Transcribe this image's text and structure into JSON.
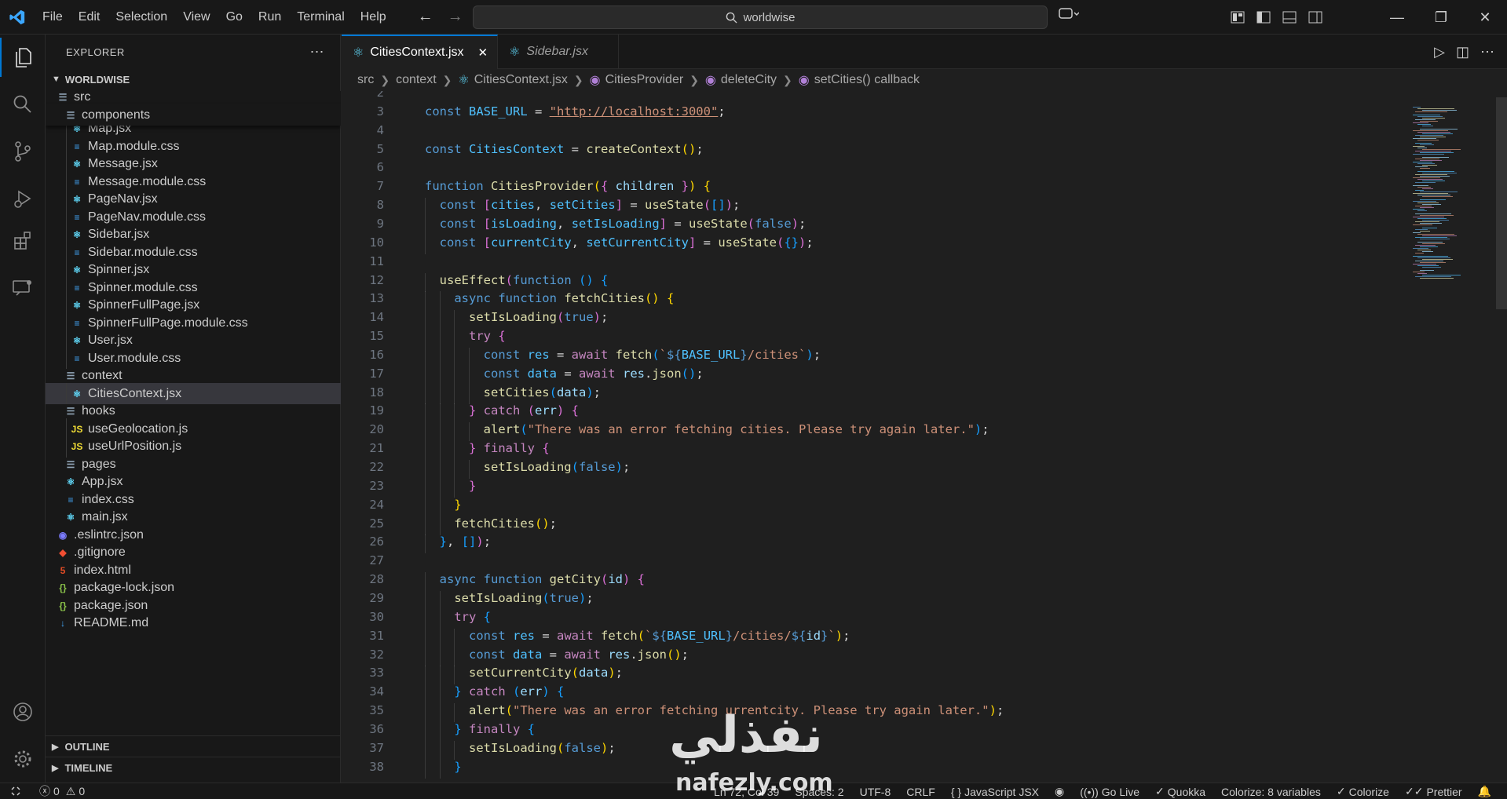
{
  "titlebar": {
    "menu": [
      "File",
      "Edit",
      "Selection",
      "View",
      "Go",
      "Run",
      "Terminal",
      "Help"
    ],
    "search_text": "worldwise"
  },
  "sidebar": {
    "header": "EXPLORER",
    "project": "WORLDWISE",
    "tree": [
      {
        "label": "src",
        "depth": 0,
        "type": "folder"
      },
      {
        "label": "components",
        "depth": 1,
        "type": "folder"
      },
      {
        "label": "Map.jsx",
        "depth": 2,
        "type": "react"
      },
      {
        "label": "Map.module.css",
        "depth": 2,
        "type": "css"
      },
      {
        "label": "Message.jsx",
        "depth": 2,
        "type": "react"
      },
      {
        "label": "Message.module.css",
        "depth": 2,
        "type": "css"
      },
      {
        "label": "PageNav.jsx",
        "depth": 2,
        "type": "react"
      },
      {
        "label": "PageNav.module.css",
        "depth": 2,
        "type": "css"
      },
      {
        "label": "Sidebar.jsx",
        "depth": 2,
        "type": "react"
      },
      {
        "label": "Sidebar.module.css",
        "depth": 2,
        "type": "css"
      },
      {
        "label": "Spinner.jsx",
        "depth": 2,
        "type": "react"
      },
      {
        "label": "Spinner.module.css",
        "depth": 2,
        "type": "css"
      },
      {
        "label": "SpinnerFullPage.jsx",
        "depth": 2,
        "type": "react"
      },
      {
        "label": "SpinnerFullPage.module.css",
        "depth": 2,
        "type": "css"
      },
      {
        "label": "User.jsx",
        "depth": 2,
        "type": "react"
      },
      {
        "label": "User.module.css",
        "depth": 2,
        "type": "css"
      },
      {
        "label": "context",
        "depth": 1,
        "type": "folder"
      },
      {
        "label": "CitiesContext.jsx",
        "depth": 2,
        "type": "react",
        "selected": true
      },
      {
        "label": "hooks",
        "depth": 1,
        "type": "folder"
      },
      {
        "label": "useGeolocation.js",
        "depth": 2,
        "type": "js"
      },
      {
        "label": "useUrlPosition.js",
        "depth": 2,
        "type": "js"
      },
      {
        "label": "pages",
        "depth": 1,
        "type": "folder"
      },
      {
        "label": "App.jsx",
        "depth": 1,
        "type": "react"
      },
      {
        "label": "index.css",
        "depth": 1,
        "type": "css"
      },
      {
        "label": "main.jsx",
        "depth": 1,
        "type": "react"
      },
      {
        "label": ".eslintrc.json",
        "depth": 0,
        "type": "eslint"
      },
      {
        "label": ".gitignore",
        "depth": 0,
        "type": "git"
      },
      {
        "label": "index.html",
        "depth": 0,
        "type": "html"
      },
      {
        "label": "package-lock.json",
        "depth": 0,
        "type": "json"
      },
      {
        "label": "package.json",
        "depth": 0,
        "type": "json"
      },
      {
        "label": "README.md",
        "depth": 0,
        "type": "md"
      }
    ],
    "outline": "OUTLINE",
    "timeline": "TIMELINE"
  },
  "tabs": [
    {
      "label": "CitiesContext.jsx",
      "active": true
    },
    {
      "label": "Sidebar.jsx",
      "active": false
    }
  ],
  "breadcrumb": [
    "src",
    "context",
    "CitiesContext.jsx",
    "CitiesProvider",
    "deleteCity",
    "setCities() callback"
  ],
  "code": {
    "first_line": 2,
    "lines": [
      [],
      [
        [
          "k",
          "const "
        ],
        [
          "c",
          "BASE_URL"
        ],
        [
          "o",
          " = "
        ],
        [
          "u",
          "\"http://localhost:3000\""
        ],
        [
          "o",
          ";"
        ]
      ],
      [],
      [
        [
          "k",
          "const "
        ],
        [
          "c",
          "CitiesContext"
        ],
        [
          "o",
          " = "
        ],
        [
          "f",
          "createContext"
        ],
        [
          "p1",
          "()"
        ],
        [
          "o",
          ";"
        ]
      ],
      [],
      [
        [
          "k",
          "function "
        ],
        [
          "f",
          "CitiesProvider"
        ],
        [
          "p1",
          "("
        ],
        [
          "p2",
          "{ "
        ],
        [
          "v",
          "children"
        ],
        [
          "p2",
          " }"
        ],
        [
          "p1",
          ")"
        ],
        [
          "o",
          " "
        ],
        [
          "p1",
          "{"
        ]
      ],
      [
        [
          "k",
          "const "
        ],
        [
          "p2",
          "["
        ],
        [
          "c",
          "cities"
        ],
        [
          "o",
          ", "
        ],
        [
          "c",
          "setCities"
        ],
        [
          "p2",
          "]"
        ],
        [
          "o",
          " = "
        ],
        [
          "f",
          "useState"
        ],
        [
          "p2",
          "("
        ],
        [
          "p3",
          "[]"
        ],
        [
          "p2",
          ")"
        ],
        [
          "o",
          ";"
        ]
      ],
      [
        [
          "k",
          "const "
        ],
        [
          "p2",
          "["
        ],
        [
          "c",
          "isLoading"
        ],
        [
          "o",
          ", "
        ],
        [
          "c",
          "setIsLoading"
        ],
        [
          "p2",
          "]"
        ],
        [
          "o",
          " = "
        ],
        [
          "f",
          "useState"
        ],
        [
          "p2",
          "("
        ],
        [
          "k",
          "false"
        ],
        [
          "p2",
          ")"
        ],
        [
          "o",
          ";"
        ]
      ],
      [
        [
          "k",
          "const "
        ],
        [
          "p2",
          "["
        ],
        [
          "c",
          "currentCity"
        ],
        [
          "o",
          ", "
        ],
        [
          "c",
          "setCurrentCity"
        ],
        [
          "p2",
          "]"
        ],
        [
          "o",
          " = "
        ],
        [
          "f",
          "useState"
        ],
        [
          "p2",
          "("
        ],
        [
          "p3",
          "{}"
        ],
        [
          "p2",
          ")"
        ],
        [
          "o",
          ";"
        ]
      ],
      [],
      [
        [
          "f",
          "useEffect"
        ],
        [
          "p2",
          "("
        ],
        [
          "k",
          "function "
        ],
        [
          "p3",
          "() {"
        ]
      ],
      [
        [
          "k",
          "async function "
        ],
        [
          "f",
          "fetchCities"
        ],
        [
          "p1",
          "() {"
        ]
      ],
      [
        [
          "f",
          "setIsLoading"
        ],
        [
          "p2",
          "("
        ],
        [
          "k",
          "true"
        ],
        [
          "p2",
          ")"
        ],
        [
          "o",
          ";"
        ]
      ],
      [
        [
          "kc",
          "try "
        ],
        [
          "p2",
          "{"
        ]
      ],
      [
        [
          "k",
          "const "
        ],
        [
          "c",
          "res"
        ],
        [
          "o",
          " = "
        ],
        [
          "kc",
          "await "
        ],
        [
          "f",
          "fetch"
        ],
        [
          "p3",
          "("
        ],
        [
          "s",
          "`"
        ],
        [
          "k",
          "${"
        ],
        [
          "c",
          "BASE_URL"
        ],
        [
          "k",
          "}"
        ],
        [
          "s",
          "/cities`"
        ],
        [
          "p3",
          ")"
        ],
        [
          "o",
          ";"
        ]
      ],
      [
        [
          "k",
          "const "
        ],
        [
          "c",
          "data"
        ],
        [
          "o",
          " = "
        ],
        [
          "kc",
          "await "
        ],
        [
          "v",
          "res"
        ],
        [
          "o",
          "."
        ],
        [
          "f",
          "json"
        ],
        [
          "p3",
          "()"
        ],
        [
          "o",
          ";"
        ]
      ],
      [
        [
          "f",
          "setCities"
        ],
        [
          "p3",
          "("
        ],
        [
          "v",
          "data"
        ],
        [
          "p3",
          ")"
        ],
        [
          "o",
          ";"
        ]
      ],
      [
        [
          "p2",
          "} "
        ],
        [
          "kc",
          "catch "
        ],
        [
          "p2",
          "("
        ],
        [
          "v",
          "err"
        ],
        [
          "p2",
          ") {"
        ]
      ],
      [
        [
          "f",
          "alert"
        ],
        [
          "p3",
          "("
        ],
        [
          "s",
          "\"There was an error fetching cities. Please try again later.\""
        ],
        [
          "p3",
          ")"
        ],
        [
          "o",
          ";"
        ]
      ],
      [
        [
          "p2",
          "} "
        ],
        [
          "kc",
          "finally "
        ],
        [
          "p2",
          "{"
        ]
      ],
      [
        [
          "f",
          "setIsLoading"
        ],
        [
          "p3",
          "("
        ],
        [
          "k",
          "false"
        ],
        [
          "p3",
          ")"
        ],
        [
          "o",
          ";"
        ]
      ],
      [
        [
          "p2",
          "}"
        ]
      ],
      [
        [
          "p1",
          "}"
        ]
      ],
      [
        [
          "f",
          "fetchCities"
        ],
        [
          "p1",
          "()"
        ],
        [
          "o",
          ";"
        ]
      ],
      [
        [
          "p3",
          "}"
        ],
        [
          "o",
          ", "
        ],
        [
          "p3",
          "[]"
        ],
        [
          "p2",
          ")"
        ],
        [
          "o",
          ";"
        ]
      ],
      [],
      [
        [
          "k",
          "async function "
        ],
        [
          "f",
          "getCity"
        ],
        [
          "p2",
          "("
        ],
        [
          "v",
          "id"
        ],
        [
          "p2",
          ") {"
        ]
      ],
      [
        [
          "f",
          "setIsLoading"
        ],
        [
          "p3",
          "("
        ],
        [
          "k",
          "true"
        ],
        [
          "p3",
          ")"
        ],
        [
          "o",
          ";"
        ]
      ],
      [
        [
          "kc",
          "try "
        ],
        [
          "p3",
          "{"
        ]
      ],
      [
        [
          "k",
          "const "
        ],
        [
          "c",
          "res"
        ],
        [
          "o",
          " = "
        ],
        [
          "kc",
          "await "
        ],
        [
          "f",
          "fetch"
        ],
        [
          "p1",
          "("
        ],
        [
          "s",
          "`"
        ],
        [
          "k",
          "${"
        ],
        [
          "c",
          "BASE_URL"
        ],
        [
          "k",
          "}"
        ],
        [
          "s",
          "/cities/"
        ],
        [
          "k",
          "${"
        ],
        [
          "v",
          "id"
        ],
        [
          "k",
          "}"
        ],
        [
          "s",
          "`"
        ],
        [
          "p1",
          ")"
        ],
        [
          "o",
          ";"
        ]
      ],
      [
        [
          "k",
          "const "
        ],
        [
          "c",
          "data"
        ],
        [
          "o",
          " = "
        ],
        [
          "kc",
          "await "
        ],
        [
          "v",
          "res"
        ],
        [
          "o",
          "."
        ],
        [
          "f",
          "json"
        ],
        [
          "p1",
          "()"
        ],
        [
          "o",
          ";"
        ]
      ],
      [
        [
          "f",
          "setCurrentCity"
        ],
        [
          "p1",
          "("
        ],
        [
          "v",
          "data"
        ],
        [
          "p1",
          ")"
        ],
        [
          "o",
          ";"
        ]
      ],
      [
        [
          "p3",
          "} "
        ],
        [
          "kc",
          "catch "
        ],
        [
          "p3",
          "("
        ],
        [
          "v",
          "err"
        ],
        [
          "p3",
          ") {"
        ]
      ],
      [
        [
          "f",
          "alert"
        ],
        [
          "p1",
          "("
        ],
        [
          "s",
          "\"There was an error fetching urrentcity. Please try again later.\""
        ],
        [
          "p1",
          ")"
        ],
        [
          "o",
          ";"
        ]
      ],
      [
        [
          "p3",
          "} "
        ],
        [
          "kc",
          "finally "
        ],
        [
          "p3",
          "{"
        ]
      ],
      [
        [
          "f",
          "setIsLoading"
        ],
        [
          "p1",
          "("
        ],
        [
          "k",
          "false"
        ],
        [
          "p1",
          ")"
        ],
        [
          "o",
          ";"
        ]
      ],
      [
        [
          "p3",
          "}"
        ]
      ]
    ],
    "indent_levels": [
      0,
      0,
      0,
      0,
      0,
      0,
      1,
      1,
      1,
      0,
      1,
      2,
      3,
      3,
      4,
      4,
      4,
      3,
      4,
      3,
      4,
      3,
      2,
      2,
      1,
      0,
      1,
      2,
      2,
      3,
      3,
      3,
      2,
      3,
      2,
      3,
      2
    ]
  },
  "statusbar": {
    "errors": "0",
    "warnings": "0",
    "position": "Ln 72, Col 39",
    "spaces": "Spaces: 2",
    "encoding": "UTF-8",
    "eol": "CRLF",
    "language": "JavaScript JSX",
    "golive": "Go Live",
    "quokka": "Quokka",
    "colorize_vars": "Colorize: 8 variables",
    "colorize": "Colorize",
    "prettier": "Prettier"
  },
  "watermark": {
    "arabic": "نفذلي",
    "latin": "nafezly.com"
  },
  "colors": {
    "accent": "#0078d4",
    "background": "#1f1f1f",
    "sidebar": "#181818"
  }
}
